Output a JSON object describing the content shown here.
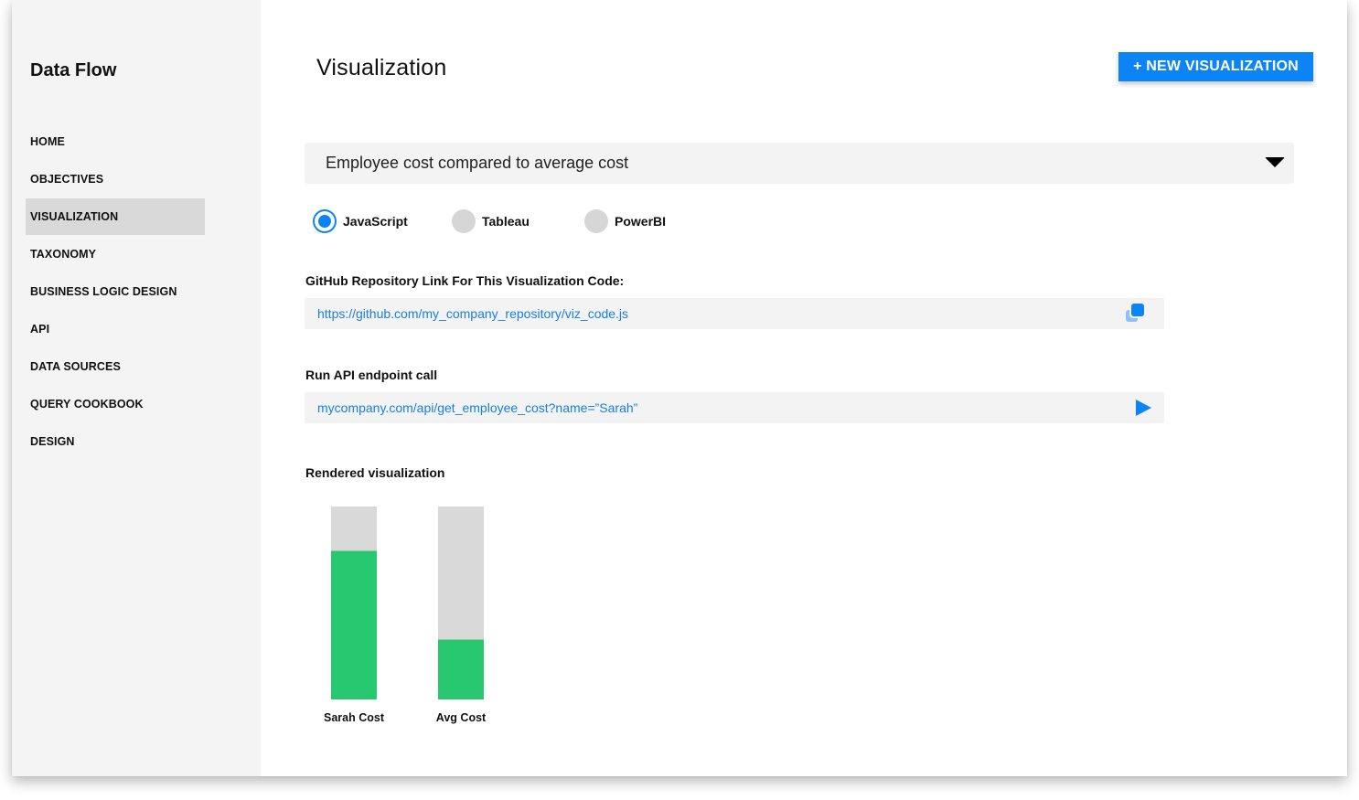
{
  "sidebar": {
    "brand": "Data Flow",
    "items": [
      {
        "label": "HOME",
        "active": false
      },
      {
        "label": "OBJECTIVES",
        "active": false
      },
      {
        "label": "VISUALIZATION",
        "active": true
      },
      {
        "label": "TAXONOMY",
        "active": false
      },
      {
        "label": "BUSINESS LOGIC DESIGN",
        "active": false
      },
      {
        "label": "API",
        "active": false
      },
      {
        "label": "DATA SOURCES",
        "active": false
      },
      {
        "label": "QUERY COOKBOOK",
        "active": false
      },
      {
        "label": "DESIGN",
        "active": false
      }
    ]
  },
  "header": {
    "title": "Visualization",
    "new_button_label": "+ NEW VISUALIZATION"
  },
  "selector": {
    "value": "Employee cost compared to average cost",
    "icon": "caret-down-icon"
  },
  "platforms": {
    "options": [
      {
        "label": "JavaScript",
        "selected": true
      },
      {
        "label": "Tableau",
        "selected": false
      },
      {
        "label": "PowerBI",
        "selected": false
      }
    ]
  },
  "repo": {
    "label": "GitHub Repository Link For This Visualization Code:",
    "value": "https://github.com/my_company_repository/viz_code.js",
    "icon": "copy-icon"
  },
  "api": {
    "label": "Run API endpoint call",
    "value": "mycompany.com/api/get_employee_cost?name=”Sarah”",
    "icon": "play-icon"
  },
  "visualization": {
    "label": "Rendered visualization"
  },
  "colors": {
    "accent": "#0d84f5",
    "bar_fill": "#27c86f",
    "bar_track": "#d9d9d9"
  },
  "chart_data": {
    "type": "bar",
    "categories": [
      "Sarah Cost",
      "Avg Cost"
    ],
    "values": [
      0.77,
      0.31
    ],
    "ylim": [
      0,
      1
    ],
    "grid": false,
    "title": "",
    "xlabel": "",
    "ylabel": ""
  }
}
